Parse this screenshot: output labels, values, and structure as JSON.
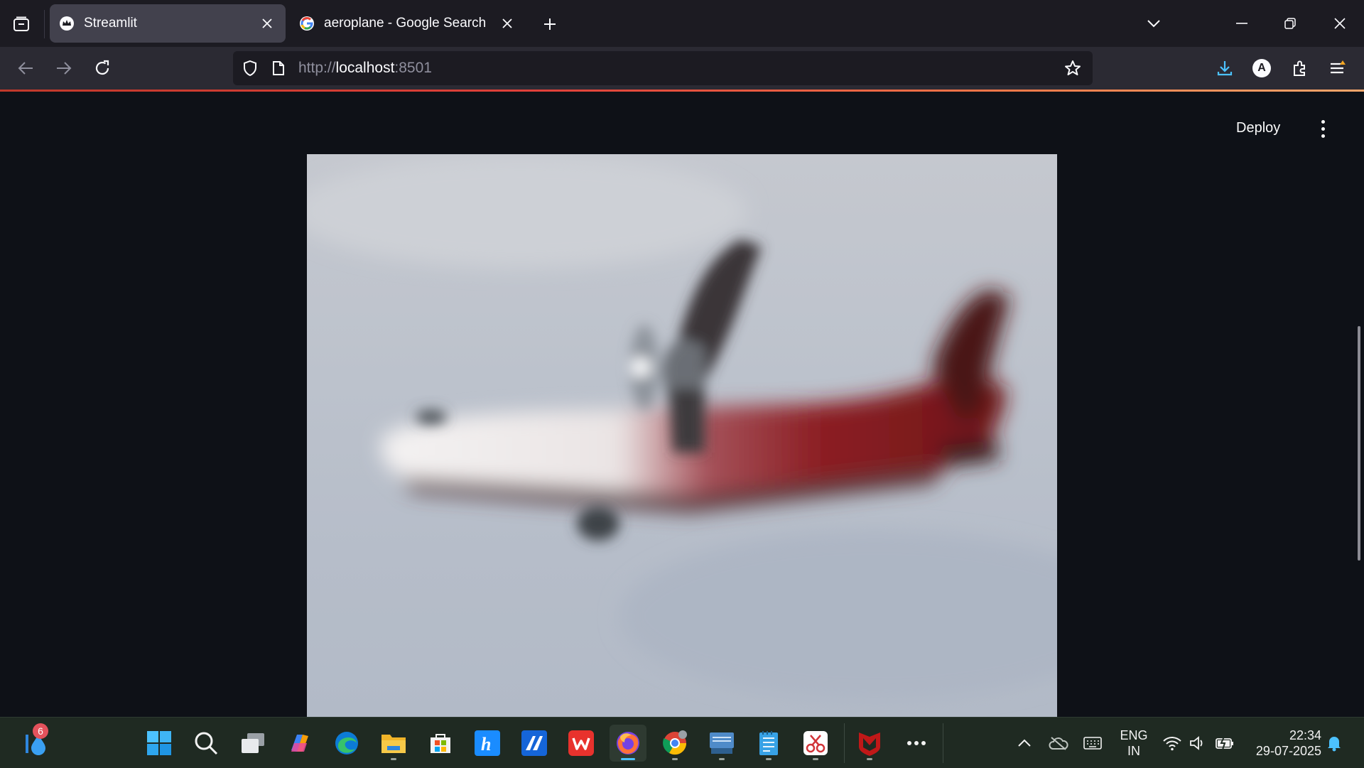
{
  "browser": {
    "tabs": [
      {
        "title": "Streamlit",
        "active": true
      },
      {
        "title": "aeroplane - Google Search",
        "active": false
      }
    ],
    "url": {
      "scheme": "http://",
      "host": "localhost",
      "port": ":8501"
    },
    "profile_initial": "A"
  },
  "app": {
    "deploy_label": "Deploy",
    "image_subject": "blurred aeroplane photo"
  },
  "taskbar": {
    "widget_badge": "6",
    "lang_line1": "ENG",
    "lang_line2": "IN",
    "time": "22:34",
    "date": "29-07-2025"
  },
  "colors": {
    "accent": "#4cc2ff",
    "streamlit_bg": "#0e1117",
    "browser_tab_active": "#42414d",
    "plane_livery": "#8c1f24"
  }
}
